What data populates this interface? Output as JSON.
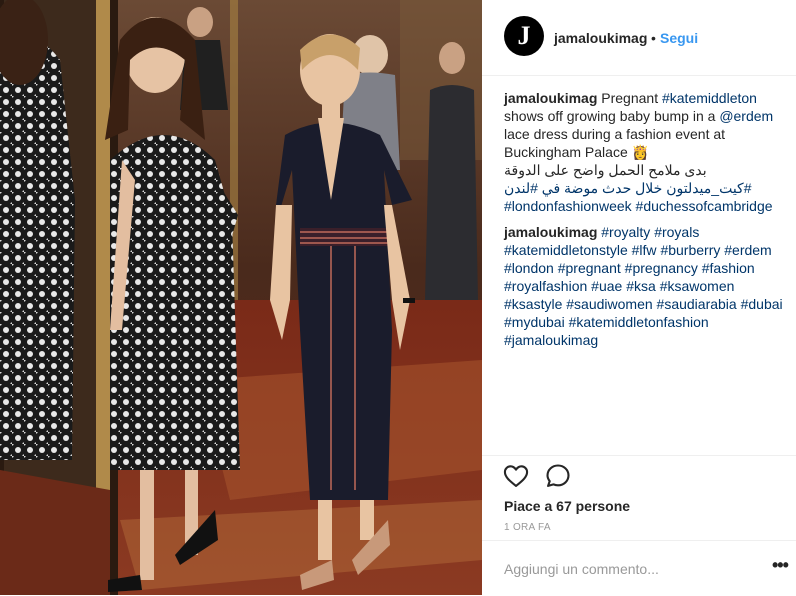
{
  "post": {
    "username": "jamaloukimag",
    "follow_label": "Segui",
    "separator": "•",
    "avatar_letter": "J"
  },
  "caption": {
    "username": "jamaloukimag",
    "text_1": "Pregnant ",
    "tag_1": "#katemiddleton",
    "text_2": " shows off growing baby bump in a ",
    "mention": "@erdem",
    "text_3": " lace dress during a fashion event at Buckingham Palace ",
    "emoji": "👸",
    "arabic": "بدى ملامح الحمل واضح على الدوقة",
    "arabic_2": "#كيت_ميدلتون خلال حدث موضة في  #لندن",
    "tag_2": "#londonfashionweek",
    "tag_3": "#duchessofcambridge"
  },
  "comment": {
    "username": "jamaloukimag",
    "tags": [
      "#royalty",
      "#royals",
      "#katemiddletonstyle",
      "#lfw",
      "#burberry",
      "#erdem",
      "#london",
      "#pregnant",
      "#pregnancy",
      "#fashion",
      "#royalfashion",
      "#uae",
      "#ksa",
      "#ksawomen",
      "#ksastyle",
      "#saudiwomen",
      "#saudiarabia",
      "#dubai",
      "#mydubai",
      "#katemiddletonfashion",
      "#jamaloukimag"
    ]
  },
  "likes_text": "Piace a 67 persone",
  "time_text": "1 ORA FA",
  "add_comment_placeholder": "Aggiungi un commento...",
  "more_label": "•••",
  "icons": {
    "like": "heart-icon",
    "comment": "comment-bubble-icon",
    "more": "more-options-icon"
  }
}
